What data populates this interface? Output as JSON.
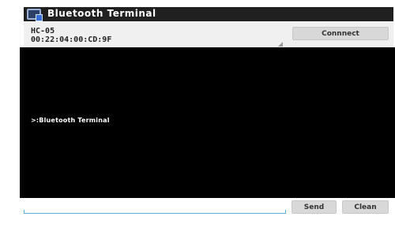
{
  "app": {
    "title": "Bluetooth Terminal"
  },
  "device": {
    "name": "HC-05",
    "address": "00:22:04:00:CD:9F"
  },
  "buttons": {
    "connect": "Connnect",
    "send": "Send",
    "clean": "Clean"
  },
  "terminal": {
    "lines": [
      ">:Bluetooth Terminal"
    ]
  },
  "input": {
    "value": "",
    "placeholder": ""
  },
  "colors": {
    "titlebar": "#202020",
    "terminal_bg": "#000000",
    "terminal_text": "#ffffff",
    "input_underline": "#5aaee0",
    "button_bg": "#d8d8d8"
  },
  "icons": {
    "app": "bluetooth-terminal-app-icon"
  }
}
